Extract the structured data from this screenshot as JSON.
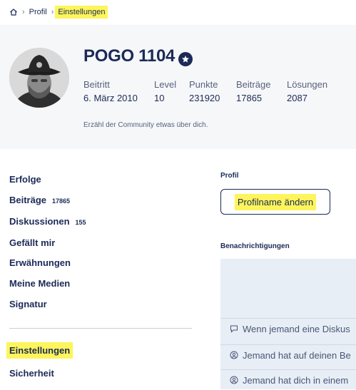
{
  "breadcrumb": {
    "profile": "Profil",
    "current": "Einstellungen"
  },
  "profile": {
    "username": "POGO 1104",
    "stats": [
      {
        "label": "Beitritt",
        "value": "6. März 2010"
      },
      {
        "label": "Level",
        "value": "10"
      },
      {
        "label": "Punkte",
        "value": "231920"
      },
      {
        "label": "Beiträge",
        "value": "17865"
      },
      {
        "label": "Lösungen",
        "value": "2087"
      }
    ],
    "bio_placeholder": "Erzähl der Community etwas über dich."
  },
  "nav": {
    "items": [
      {
        "label": "Erfolge",
        "count": ""
      },
      {
        "label": "Beiträge",
        "count": "17865"
      },
      {
        "label": "Diskussionen",
        "count": "155"
      },
      {
        "label": "Gefällt mir",
        "count": ""
      },
      {
        "label": "Erwähnungen",
        "count": ""
      },
      {
        "label": "Meine Medien",
        "count": ""
      },
      {
        "label": "Signatur",
        "count": ""
      }
    ],
    "settings": "Einstellungen",
    "security": "Sicherheit"
  },
  "settings": {
    "profile_section": "Profil",
    "change_name_button": "Profilname ändern",
    "notifications_section": "Benachrichtigungen",
    "notification_rows": [
      "Wenn jemand eine Diskus",
      "Jemand hat auf deinen Be",
      "Jemand hat dich in einem"
    ]
  },
  "colors": {
    "text_primary": "#1b2a57",
    "highlight": "#fdf55b",
    "header_bg": "#f6f7f9",
    "panel_bg": "#e7eef6"
  }
}
